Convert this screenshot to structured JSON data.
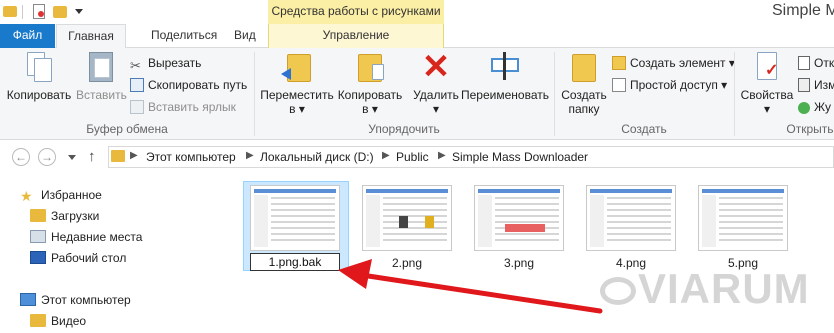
{
  "window": {
    "title": "Simple Mas",
    "context_tab_group": "Средства работы с рисунками"
  },
  "tabs": {
    "file": "Файл",
    "home": "Главная",
    "share": "Поделиться",
    "view": "Вид",
    "manage": "Управление"
  },
  "ribbon": {
    "clipboard": {
      "copy": "Копировать",
      "paste": "Вставить",
      "cut": "Вырезать",
      "copy_path": "Скопировать путь",
      "paste_shortcut": "Вставить ярлык",
      "group_label": "Буфер обмена"
    },
    "organize": {
      "move_to_line1": "Переместить",
      "move_to_line2": "в ▾",
      "copy_to_line1": "Копировать",
      "copy_to_line2": "в ▾",
      "delete_line1": "Удалить",
      "delete_line2": "▾",
      "rename": "Переименовать",
      "group_label": "Упорядочить"
    },
    "create": {
      "new_folder_line1": "Создать",
      "new_folder_line2": "папку",
      "new_item": "Создать элемент ▾",
      "easy_access": "Простой доступ ▾",
      "group_label": "Создать"
    },
    "open": {
      "properties_line1": "Свойства",
      "properties_line2": "▾",
      "open_item": "Отк",
      "edit_item": "Изм",
      "history_item": "Жу",
      "group_label": "Открыть"
    }
  },
  "address": {
    "crumbs": [
      "Этот компьютер",
      "Локальный диск (D:)",
      "Public",
      "Simple Mass Downloader"
    ]
  },
  "nav": {
    "favorites": "Избранное",
    "downloads": "Загрузки",
    "recent": "Недавние места",
    "desktop": "Рабочий стол",
    "this_pc": "Этот компьютер",
    "video": "Видео"
  },
  "files": [
    {
      "name": "1.png.bak",
      "renaming": true
    },
    {
      "name": "2.png"
    },
    {
      "name": "3.png"
    },
    {
      "name": "4.png"
    },
    {
      "name": "5.png"
    }
  ],
  "watermark": "VIARUM",
  "colors": {
    "file_tab": "#1979ca",
    "context_tab": "#fbeea5",
    "selection": "#cce8ff",
    "arrow": "#e0181c"
  }
}
